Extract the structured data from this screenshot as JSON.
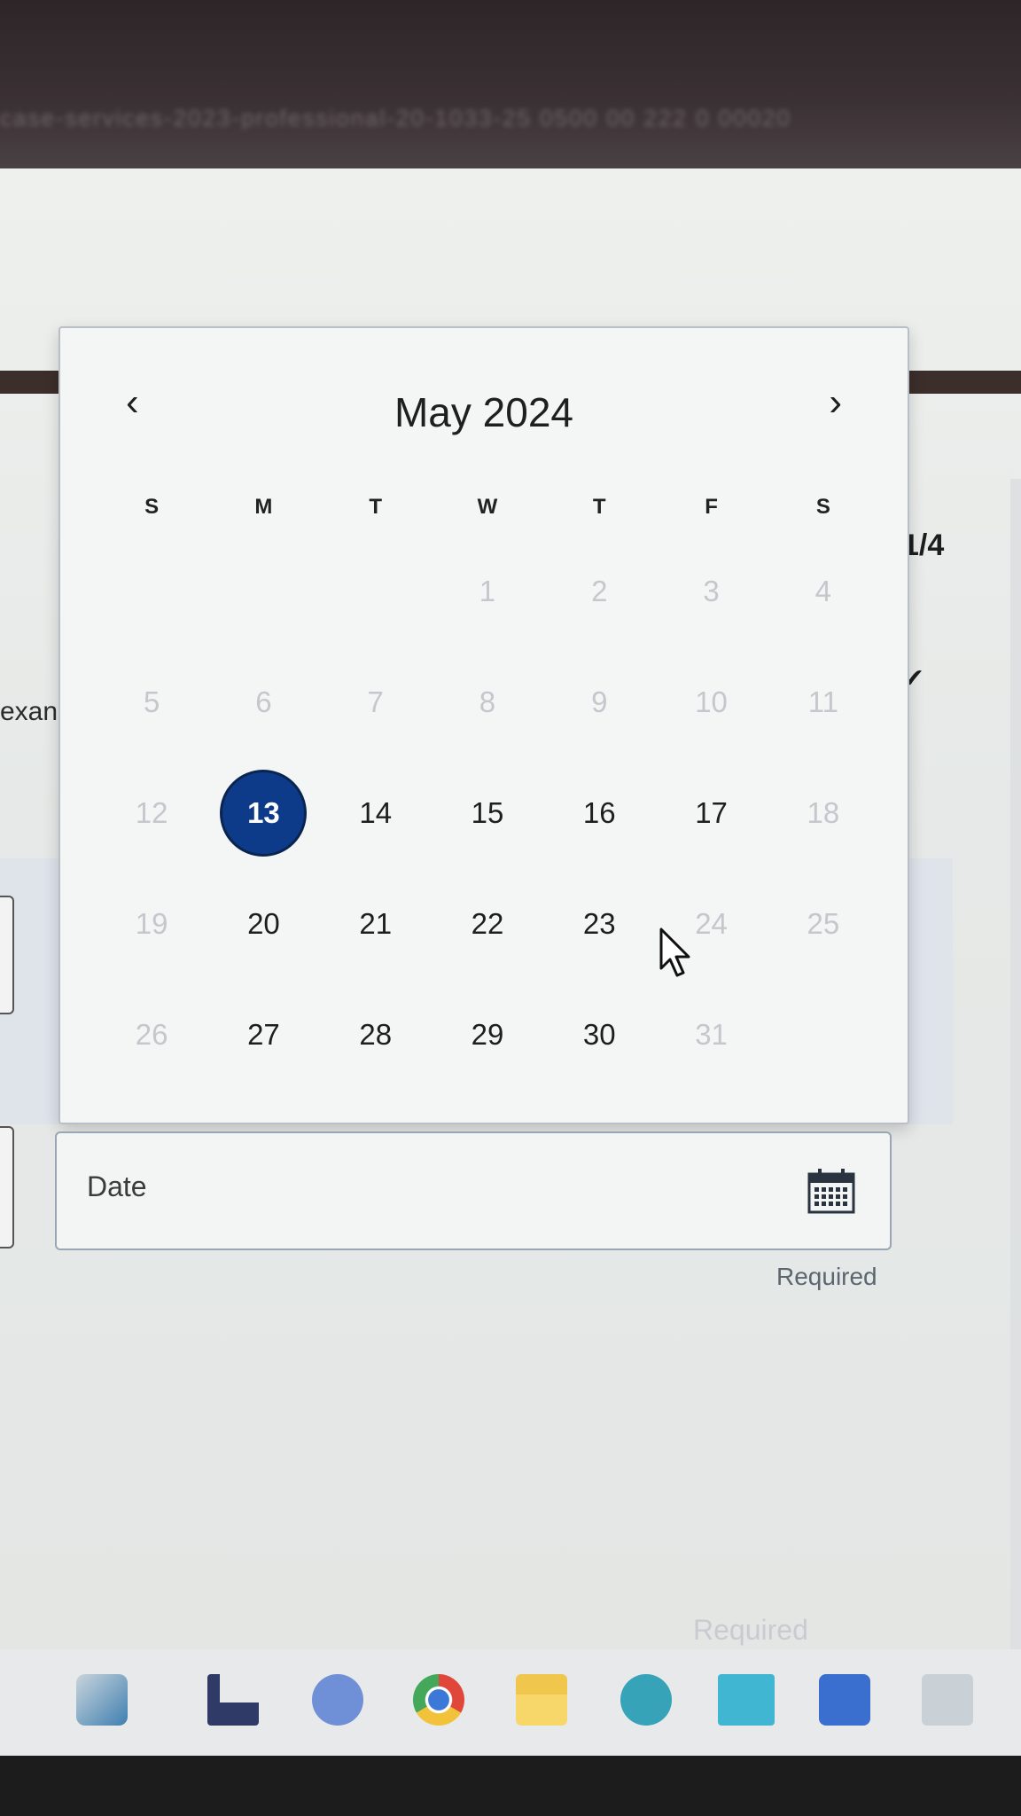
{
  "browser": {
    "url_fragment": "case-services-2023-professional-20-1033-25 0500 00 222 0 00020"
  },
  "background": {
    "step_counter": "1/4",
    "check_icon": "checkmark-icon",
    "left_text_fragment": "exan"
  },
  "calendar": {
    "month_label": "May 2024",
    "prev_icon": "chevron-left-icon",
    "next_icon": "chevron-right-icon",
    "prev_glyph": "‹",
    "next_glyph": "›",
    "selected_day": 13,
    "weekdays": [
      "S",
      "M",
      "T",
      "W",
      "T",
      "F",
      "S"
    ],
    "weeks": [
      [
        null,
        null,
        null,
        "1",
        "2",
        "3",
        "4"
      ],
      [
        "5",
        "6",
        "7",
        "8",
        "9",
        "10",
        "11"
      ],
      [
        "12",
        "13",
        "14",
        "15",
        "16",
        "17",
        "18"
      ],
      [
        "19",
        "20",
        "21",
        "22",
        "23",
        "24",
        "25"
      ],
      [
        "26",
        "27",
        "28",
        "29",
        "30",
        "31",
        null
      ]
    ],
    "enabled_days": [
      "13",
      "14",
      "15",
      "16",
      "17",
      "20",
      "21",
      "22",
      "23",
      "27",
      "28",
      "29",
      "30"
    ]
  },
  "date_field": {
    "label": "Date",
    "icon": "calendar-icon",
    "helper": "Required"
  },
  "footer": {
    "faded_required": "Required"
  },
  "taskbar": {
    "icons": [
      "pen-app-icon",
      "files-icon",
      "meet-icon",
      "chrome-icon",
      "folder-icon",
      "help-icon",
      "mobile-app-icon",
      "store-icon",
      "media-player-icon"
    ]
  },
  "colors": {
    "selected_fill": "#0d3b8a",
    "disabled_text": "#c4c8cc"
  }
}
